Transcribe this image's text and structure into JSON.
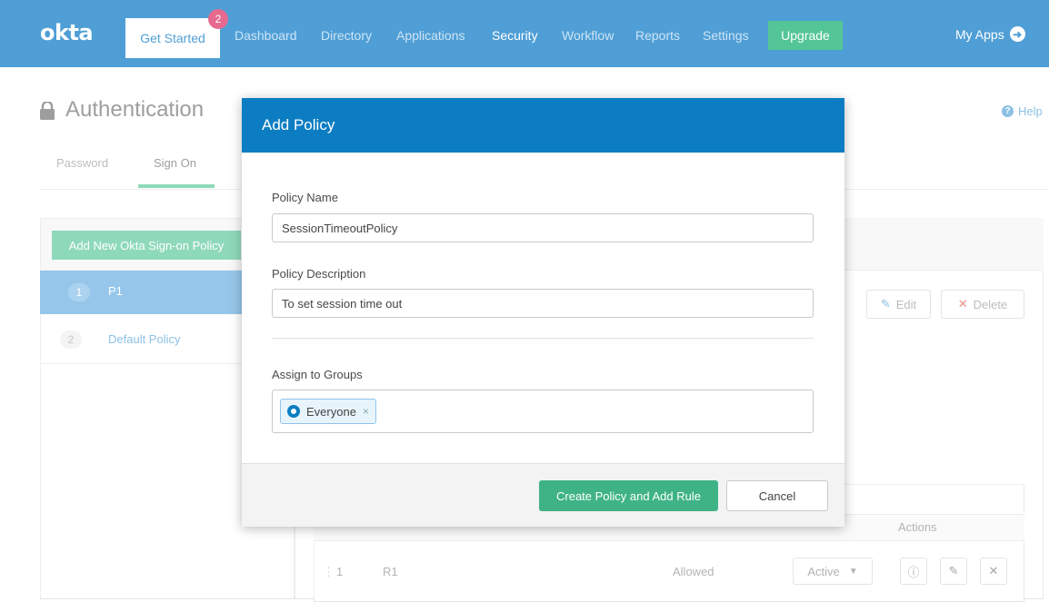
{
  "nav": {
    "logo": "okta",
    "get_started": "Get Started",
    "badge_count": "2",
    "items": [
      {
        "label": "Dashboard"
      },
      {
        "label": "Directory"
      },
      {
        "label": "Applications"
      },
      {
        "label": "Security"
      },
      {
        "label": "Workflow"
      },
      {
        "label": "Reports"
      },
      {
        "label": "Settings"
      }
    ],
    "upgrade": "Upgrade",
    "my_apps": "My Apps",
    "active_item": "Security"
  },
  "page": {
    "title": "Authentication",
    "help": "Help",
    "tabs": [
      {
        "label": "Password"
      },
      {
        "label": "Sign On"
      }
    ],
    "active_tab": "Sign On"
  },
  "policies": {
    "add_button": "Add New Okta Sign-on Policy",
    "list": [
      {
        "number": "1",
        "name": "P1"
      },
      {
        "number": "2",
        "name": "Default Policy"
      }
    ]
  },
  "policy_actions": {
    "edit": "Edit",
    "delete": "Delete"
  },
  "rules_table": {
    "actions_header": "Actions",
    "rows": [
      {
        "priority": "1",
        "name": "R1",
        "access": "Allowed",
        "status": "Active"
      }
    ]
  },
  "modal": {
    "title": "Add Policy",
    "policy_name_label": "Policy Name",
    "policy_name_value": "SessionTimeoutPolicy",
    "policy_description_label": "Policy Description",
    "policy_description_value": "To set session time out",
    "assign_groups_label": "Assign to Groups",
    "groups": [
      {
        "name": "Everyone"
      }
    ],
    "primary_button": "Create Policy and Add Rule",
    "cancel_button": "Cancel"
  },
  "colors": {
    "nav_bg": "#4f9fd6",
    "modal_header": "#0c7dc2",
    "accent_green": "#3fb386",
    "badge_pink": "#e66a8f"
  }
}
